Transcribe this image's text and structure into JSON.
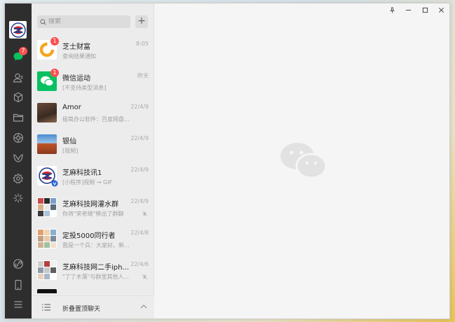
{
  "colors": {
    "rail": "#2e2e2e",
    "list_bg": "#ececec",
    "badge": "#fa5151",
    "wechat_green": "#07c160"
  },
  "nav": {
    "chat_badge": "7",
    "icons": [
      "chat-icon",
      "contacts-icon",
      "favorites-icon",
      "folder-icon",
      "moments-icon",
      "channels-icon",
      "mini-program-icon",
      "discover-icon",
      "link-icon",
      "phone-icon",
      "menu-icon"
    ]
  },
  "search": {
    "placeholder": "搜索",
    "add_label": "+"
  },
  "chats": [
    {
      "name": "芝士财富",
      "time": "8:05",
      "message": "查询结果通知",
      "badge": "1"
    },
    {
      "name": "微信运动",
      "time": "昨天",
      "message": "[不支持类型消息]",
      "badge": "1"
    },
    {
      "name": "Amor",
      "time": "22/4/9",
      "message": "极简办公软件：百度网盘..."
    },
    {
      "name": "银仙",
      "time": "22/4/9",
      "message": "[视频]"
    },
    {
      "name": "芝麻科技讯1",
      "time": "22/4/9",
      "message": "[小程序]视频 → GIF"
    },
    {
      "name": "芝麻科技网灌水群",
      "time": "22/4/9",
      "message": "你将\"宋老缝\"移出了群聊"
    },
    {
      "name": "定投5000同行者",
      "time": "22/4/8",
      "message": "我是一个兵：大家好。新..."
    },
    {
      "name": "芝麻科技网二手iph...",
      "time": "22/4/6",
      "message": "\"了了木落\"与群里其他人..."
    }
  ],
  "footer": {
    "label": "折叠置顶聊天"
  }
}
